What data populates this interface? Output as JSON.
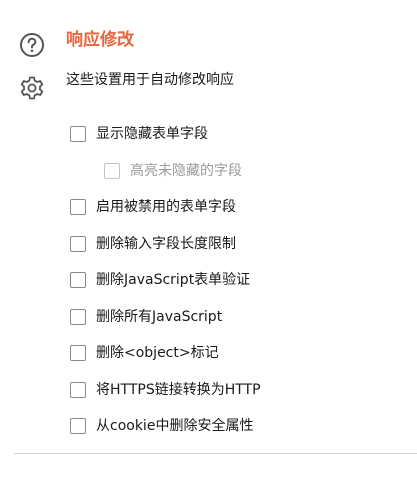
{
  "sidebar": {
    "icons": [
      "help-circle-icon",
      "gear-icon"
    ]
  },
  "section": {
    "title": "响应修改",
    "description": "这些设置用于自动修改响应"
  },
  "options": [
    {
      "label": "显示隐藏表单字段",
      "checked": false,
      "disabled": false,
      "indent": false
    },
    {
      "label": "高亮未隐藏的字段",
      "checked": false,
      "disabled": true,
      "indent": true
    },
    {
      "label": "启用被禁用的表单字段",
      "checked": false,
      "disabled": false,
      "indent": false
    },
    {
      "label": "删除输入字段长度限制",
      "checked": false,
      "disabled": false,
      "indent": false
    },
    {
      "label": "删除JavaScript表单验证",
      "checked": false,
      "disabled": false,
      "indent": false
    },
    {
      "label": "删除所有JavaScript",
      "checked": false,
      "disabled": false,
      "indent": false
    },
    {
      "label": "删除<object>标记",
      "checked": false,
      "disabled": false,
      "indent": false
    },
    {
      "label": "将HTTPS链接转换为HTTP",
      "checked": false,
      "disabled": false,
      "indent": false
    },
    {
      "label": "从cookie中删除安全属性",
      "checked": false,
      "disabled": false,
      "indent": false
    }
  ],
  "colors": {
    "accent": "#e8663d",
    "text": "#1a1a1a",
    "disabled_text": "#9a9a9a",
    "checkbox_border": "#8a8a8a"
  }
}
